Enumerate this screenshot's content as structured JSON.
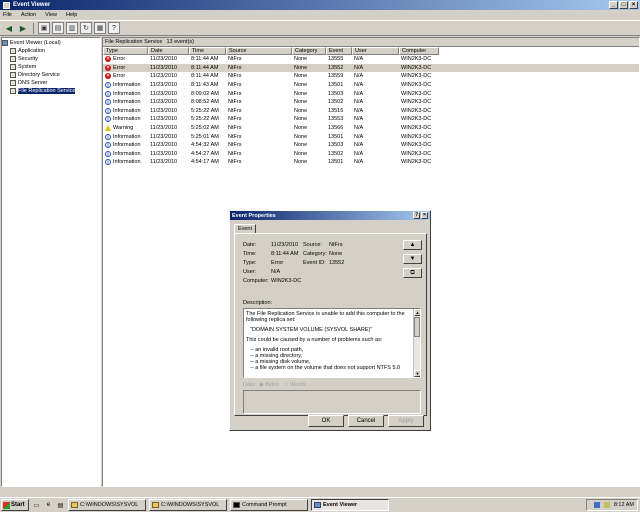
{
  "window": {
    "title": "Event Viewer"
  },
  "menu": [
    "File",
    "Action",
    "View",
    "Help"
  ],
  "tree": [
    {
      "label": "Event Viewer (Local)",
      "level": 0
    },
    {
      "label": "Application",
      "level": 1
    },
    {
      "label": "Security",
      "level": 1
    },
    {
      "label": "System",
      "level": 1
    },
    {
      "label": "Directory Service",
      "level": 1
    },
    {
      "label": "DNS Server",
      "level": 1
    },
    {
      "label": "File Replication Service",
      "level": 1,
      "selected": true
    }
  ],
  "list": {
    "caption": "File Replication Service",
    "count": "13 event(s)",
    "columns": [
      "Type",
      "Date",
      "Time",
      "Source",
      "Category",
      "Event",
      "User",
      "Computer"
    ],
    "rows": [
      {
        "type": "Error",
        "icon": "error",
        "date": "11/23/2010",
        "time": "8:11:44 AM",
        "source": "NtFrs",
        "category": "None",
        "event": "13555",
        "user": "N/A",
        "computer": "WIN2K3-DC"
      },
      {
        "type": "Error",
        "icon": "error",
        "date": "11/23/2010",
        "time": "8:11:44 AM",
        "source": "NtFrs",
        "category": "None",
        "event": "13552",
        "user": "N/A",
        "computer": "WIN2K3-DC",
        "selected": true
      },
      {
        "type": "Error",
        "icon": "error",
        "date": "11/23/2010",
        "time": "8:11:44 AM",
        "source": "NtFrs",
        "category": "None",
        "event": "13559",
        "user": "N/A",
        "computer": "WIN2K3-DC"
      },
      {
        "type": "Information",
        "icon": "info",
        "date": "11/23/2010",
        "time": "8:11:43 AM",
        "source": "NtFrs",
        "category": "None",
        "event": "13501",
        "user": "N/A",
        "computer": "WIN2K3-DC"
      },
      {
        "type": "Information",
        "icon": "info",
        "date": "11/23/2010",
        "time": "8:09:02 AM",
        "source": "NtFrs",
        "category": "None",
        "event": "13503",
        "user": "N/A",
        "computer": "WIN2K3-DC"
      },
      {
        "type": "Information",
        "icon": "info",
        "date": "11/23/2010",
        "time": "8:08:52 AM",
        "source": "NtFrs",
        "category": "None",
        "event": "13502",
        "user": "N/A",
        "computer": "WIN2K3-DC"
      },
      {
        "type": "Information",
        "icon": "info",
        "date": "11/23/2010",
        "time": "5:25:22 AM",
        "source": "NtFrs",
        "category": "None",
        "event": "13516",
        "user": "N/A",
        "computer": "WIN2K3-DC"
      },
      {
        "type": "Information",
        "icon": "info",
        "date": "11/23/2010",
        "time": "5:25:22 AM",
        "source": "NtFrs",
        "category": "None",
        "event": "13553",
        "user": "N/A",
        "computer": "WIN2K3-DC"
      },
      {
        "type": "Warning",
        "icon": "warning",
        "date": "11/23/2010",
        "time": "5:25:02 AM",
        "source": "NtFrs",
        "category": "None",
        "event": "13566",
        "user": "N/A",
        "computer": "WIN2K3-DC"
      },
      {
        "type": "Information",
        "icon": "info",
        "date": "11/23/2010",
        "time": "5:25:01 AM",
        "source": "NtFrs",
        "category": "None",
        "event": "13501",
        "user": "N/A",
        "computer": "WIN2K3-DC"
      },
      {
        "type": "Information",
        "icon": "info",
        "date": "11/23/2010",
        "time": "4:54:32 AM",
        "source": "NtFrs",
        "category": "None",
        "event": "13503",
        "user": "N/A",
        "computer": "WIN2K3-DC"
      },
      {
        "type": "Information",
        "icon": "info",
        "date": "11/23/2010",
        "time": "4:54:27 AM",
        "source": "NtFrs",
        "category": "None",
        "event": "13502",
        "user": "N/A",
        "computer": "WIN2K3-DC"
      },
      {
        "type": "Information",
        "icon": "info",
        "date": "11/23/2010",
        "time": "4:54:17 AM",
        "source": "NtFrs",
        "category": "None",
        "event": "13501",
        "user": "N/A",
        "computer": "WIN2K3-DC"
      }
    ]
  },
  "dialog": {
    "title": "Event Properties",
    "tab": "Event",
    "date_label": "Date:",
    "date": "11/23/2010",
    "source_label": "Source:",
    "source": "NtFrs",
    "time_label": "Time:",
    "time": "8:11:44 AM",
    "category_label": "Category:",
    "category": "None",
    "type_label": "Type:",
    "type": "Error",
    "eventid_label": "Event ID:",
    "eventid": "13552",
    "user_label": "User:",
    "user": "N/A",
    "computer_label": "Computer:",
    "computer": "WIN2K3-DC",
    "description_label": "Description:",
    "description_p1": "The File Replication Service is unable to add this computer to the following replica set:",
    "description_set": "\"DOMAIN SYSTEM VOLUME (SYSVOL SHARE)\"",
    "description_p2": "This could be caused by a number of problems such as:",
    "causes": [
      "--  an invalid root path,",
      "--  a missing directory,",
      "--  a missing disk volume,",
      "--  a file system on the volume that does not support NTFS 5.0"
    ],
    "data_label": "Data:",
    "bytes_label": "Bytes",
    "words_label": "Words",
    "ok": "OK",
    "cancel": "Cancel",
    "apply": "Apply"
  },
  "taskbar": {
    "start": "Start",
    "tasks": [
      {
        "label": "C:\\WINDOWS\\SYSVOL",
        "active": false
      },
      {
        "label": "C:\\WINDOWS\\SYSVOL",
        "active": false
      },
      {
        "label": "Command Prompt",
        "active": false
      },
      {
        "label": "Event Viewer",
        "active": true
      }
    ],
    "clock": "8:12 AM"
  }
}
